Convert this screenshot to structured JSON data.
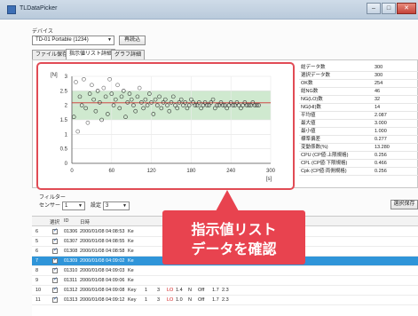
{
  "window": {
    "title": "TLDataPicker",
    "minimize": "–",
    "maximize": "□",
    "close": "✕"
  },
  "device": {
    "label": "デバイス",
    "selected": "TD-01 Portable  (1234)",
    "update_button": "再読込"
  },
  "tabs": [
    {
      "label": "ファイル保存"
    },
    {
      "label": "指示値リスト詳細",
      "active": true
    },
    {
      "label": "グラフ詳細"
    }
  ],
  "chart_data": {
    "type": "scatter",
    "ylabel": "[N]",
    "xlabel": "[s]",
    "xlim": [
      0,
      300
    ],
    "ylim": [
      0,
      3
    ],
    "x_ticks": [
      "0",
      "60",
      "120",
      "180",
      "240",
      "300"
    ],
    "y_ticks": [
      "0",
      "0.5",
      "1",
      "1.5",
      "2",
      "2.5",
      "3"
    ],
    "band_low": 1.5,
    "band_high": 2.5,
    "band_color": "#cfe9cf",
    "mean_line": 2.087,
    "series": [
      {
        "color": "#333333",
        "x": [
          3,
          6,
          9,
          12,
          15,
          18,
          21,
          24,
          27,
          30,
          33,
          36,
          39,
          42,
          45,
          48,
          51,
          54,
          57,
          60,
          63,
          66,
          69,
          72,
          75,
          78,
          81,
          84,
          87,
          90,
          93,
          96,
          99,
          102,
          105,
          108,
          111,
          114,
          117,
          120,
          123,
          126,
          129,
          132,
          135,
          138,
          141,
          144,
          147,
          150,
          153,
          156,
          159,
          162,
          165,
          168,
          171,
          174,
          177,
          180,
          183,
          186,
          189,
          192,
          195,
          198,
          201,
          204,
          207,
          210,
          213,
          216,
          219,
          222,
          225,
          228,
          231,
          234,
          237,
          240,
          243,
          246,
          249,
          252,
          255,
          258,
          261,
          264,
          267,
          270,
          273,
          276,
          279,
          282
        ],
        "y": [
          1.6,
          2.8,
          1.1,
          2.3,
          2.0,
          2.9,
          1.9,
          1.4,
          2.4,
          2.7,
          2.2,
          1.8,
          2.5,
          2.1,
          1.5,
          2.6,
          2.3,
          1.7,
          2.9,
          2.4,
          2.0,
          2.2,
          2.7,
          1.9,
          2.3,
          2.5,
          1.6,
          2.1,
          2.4,
          2.2,
          2.0,
          1.8,
          2.3,
          2.6,
          2.1,
          1.9,
          2.2,
          2.0,
          2.4,
          2.1,
          1.7,
          2.2,
          2.0,
          2.3,
          1.9,
          2.1,
          2.2,
          2.0,
          1.8,
          2.1,
          2.3,
          2.0,
          1.9,
          2.1,
          2.2,
          2.0,
          2.1,
          1.9,
          2.0,
          2.2,
          2.1,
          2.0,
          2.0,
          2.1,
          1.9,
          2.0,
          2.1,
          2.0,
          2.0,
          2.1,
          2.2,
          1.9,
          2.0,
          2.0,
          2.1,
          2.0,
          2.0,
          1.9,
          2.0,
          2.1,
          2.0,
          2.0,
          2.1,
          2.0,
          1.9,
          2.0,
          2.1,
          2.0,
          2.0,
          2.0,
          2.1,
          2.0,
          2.0,
          2.0
        ]
      }
    ]
  },
  "stats": [
    {
      "k": "総データ数",
      "v": "300"
    },
    {
      "k": "選択データ数",
      "v": "300"
    },
    {
      "k": "OK数",
      "v": "254"
    },
    {
      "k": "総NG数",
      "v": "46"
    },
    {
      "k": "NG(LO)数",
      "v": "32"
    },
    {
      "k": "NG(HI)数",
      "v": "14"
    },
    {
      "k": "平均値",
      "v": "2.087"
    },
    {
      "k": "最大値",
      "v": "3.000"
    },
    {
      "k": "最小値",
      "v": "1.000"
    },
    {
      "k": "標準偏差",
      "v": "0.277"
    },
    {
      "k": "変動係数(%)",
      "v": "13.280"
    },
    {
      "k": "CPU (CP値:上限規格)",
      "v": "0.256"
    },
    {
      "k": "CPL (CP値:下限規格)",
      "v": "0.466"
    },
    {
      "k": "Cpk (CP値:両側規格)",
      "v": "0.256"
    }
  ],
  "filter": {
    "label": "フィルター",
    "sensor_label": "センサー",
    "sensor_value": "1",
    "setting_label": "設定",
    "setting_value": "3",
    "save_button": "選択保存"
  },
  "table": {
    "headers": [
      "選択",
      "ID",
      "日時"
    ],
    "rows": [
      {
        "idx": "6",
        "checked": true,
        "id": "01306",
        "date": "2000/01/08 04:08:53",
        "type": "Ke"
      },
      {
        "idx": "5",
        "checked": true,
        "id": "01307",
        "date": "2000/01/08 04:08:55",
        "type": "Ke"
      },
      {
        "idx": "6",
        "checked": true,
        "id": "01308",
        "date": "2000/01/08 04:08:58",
        "type": "Ke"
      },
      {
        "idx": "7",
        "checked": true,
        "id": "01309",
        "date": "2000/01/08 04:09:02",
        "type": "Ke",
        "selected": true
      },
      {
        "idx": "8",
        "checked": true,
        "id": "01310",
        "date": "2000/01/08 04:09:03",
        "type": "Ke"
      },
      {
        "idx": "9",
        "checked": true,
        "id": "01311",
        "date": "2000/01/08 04:09:06",
        "type": "Ke"
      },
      {
        "idx": "10",
        "checked": true,
        "id": "01312",
        "date": "2000/01/08 04:09:08",
        "type": "Key",
        "n1": "1",
        "n2": "3",
        "flag": "LO",
        "val": "1.4",
        "mode": "N",
        "sw": "Off",
        "a": "1.7",
        "b": "2.3"
      },
      {
        "idx": "11",
        "checked": true,
        "id": "01313",
        "date": "2000/01/08 04:09:12",
        "type": "Key",
        "n1": "1",
        "n2": "3",
        "flag": "LO",
        "val": "1.0",
        "mode": "N",
        "sw": "Off",
        "a": "1.7",
        "b": "2.3"
      }
    ]
  },
  "callout": {
    "line1": "指示値リスト",
    "line2": "データを確認"
  }
}
